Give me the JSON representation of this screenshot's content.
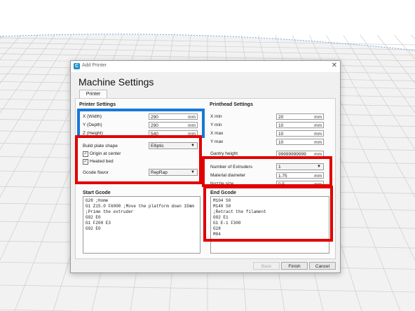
{
  "window": {
    "title": "Add Printer",
    "icon": "cura-app-icon",
    "close_glyph": "✕"
  },
  "heading": "Machine Settings",
  "tab": "Printer",
  "printer_settings": {
    "title": "Printer Settings",
    "fields": [
      {
        "label": "X (Width)",
        "value": "290",
        "unit": "mm"
      },
      {
        "label": "Y (Depth)",
        "value": "290",
        "unit": "mm"
      },
      {
        "label": "Z (Height)",
        "value": "540",
        "unit": "mm"
      }
    ],
    "build_plate_shape": {
      "label": "Build plate shape",
      "value": "Elliptic"
    },
    "origin_at_center": {
      "label": "Origin at center",
      "checked": true
    },
    "heated_bed": {
      "label": "Heated bed",
      "checked": true
    },
    "gcode_flavor": {
      "label": "Gcode flavor",
      "value": "RepRap"
    }
  },
  "printhead_settings": {
    "title": "Printhead Settings",
    "fields": [
      {
        "label": "X min",
        "value": "20",
        "unit": "mm"
      },
      {
        "label": "Y min",
        "value": "10",
        "unit": "mm"
      },
      {
        "label": "X max",
        "value": "10",
        "unit": "mm"
      },
      {
        "label": "Y max",
        "value": "10",
        "unit": "mm"
      }
    ],
    "gantry_height": {
      "label": "Gantry height",
      "value": "99999999999",
      "unit": "mm"
    },
    "extruders": {
      "label": "Number of Extruders",
      "value": "1"
    },
    "material_diameter": {
      "label": "Material diameter",
      "value": "1.75",
      "unit": "mm"
    },
    "nozzle_size": {
      "label": "Nozzle size",
      "value": "0.5",
      "unit": "mm"
    }
  },
  "start_gcode": {
    "title": "Start Gcode",
    "text": "G28 ;Home\nG1 Z15.0 F6000 ;Move the platform down 15mm\n;Prime the extruder\nG92 E0\nG1 F200 E3\nG92 E0"
  },
  "end_gcode": {
    "title": "End Gcode",
    "text": "M104 S0\nM140 S0\n;Retract the filament\nG92 E1\nG1 E-1 F300\nG28\nM84"
  },
  "buttons": {
    "back": "Back",
    "finish": "Finish",
    "cancel": "Cancel"
  },
  "colors": {
    "highlight_red": "#e10000",
    "highlight_blue": "#1778d8",
    "app_accent": "#1a8fc9"
  }
}
